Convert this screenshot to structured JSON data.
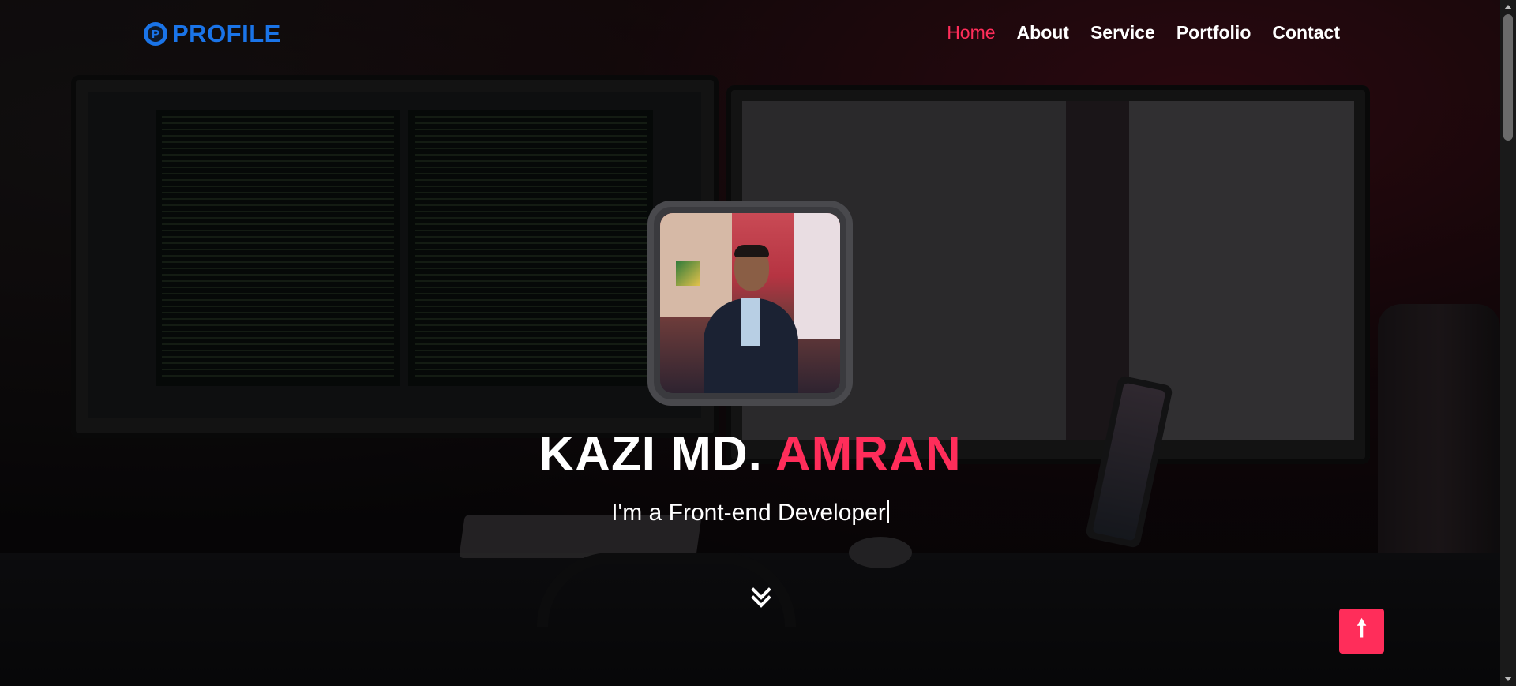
{
  "brand": {
    "logo_text": "PROFILE",
    "logo_icon": "p-circle-icon",
    "color": "#1a74e8"
  },
  "nav": {
    "items": [
      {
        "label": "Home",
        "active": true
      },
      {
        "label": "About"
      },
      {
        "label": "Service"
      },
      {
        "label": "Portfolio"
      },
      {
        "label": "Contact"
      }
    ]
  },
  "hero": {
    "name_first": "KAZI MD.",
    "name_last": "AMRAN",
    "tagline": "I'm a Front-end Developer",
    "accent_color": "#ff2d5a",
    "scroll_icon": "double-chevron-down-icon"
  },
  "back_to_top": {
    "icon": "arrow-up-icon",
    "glyph": "🠕"
  }
}
